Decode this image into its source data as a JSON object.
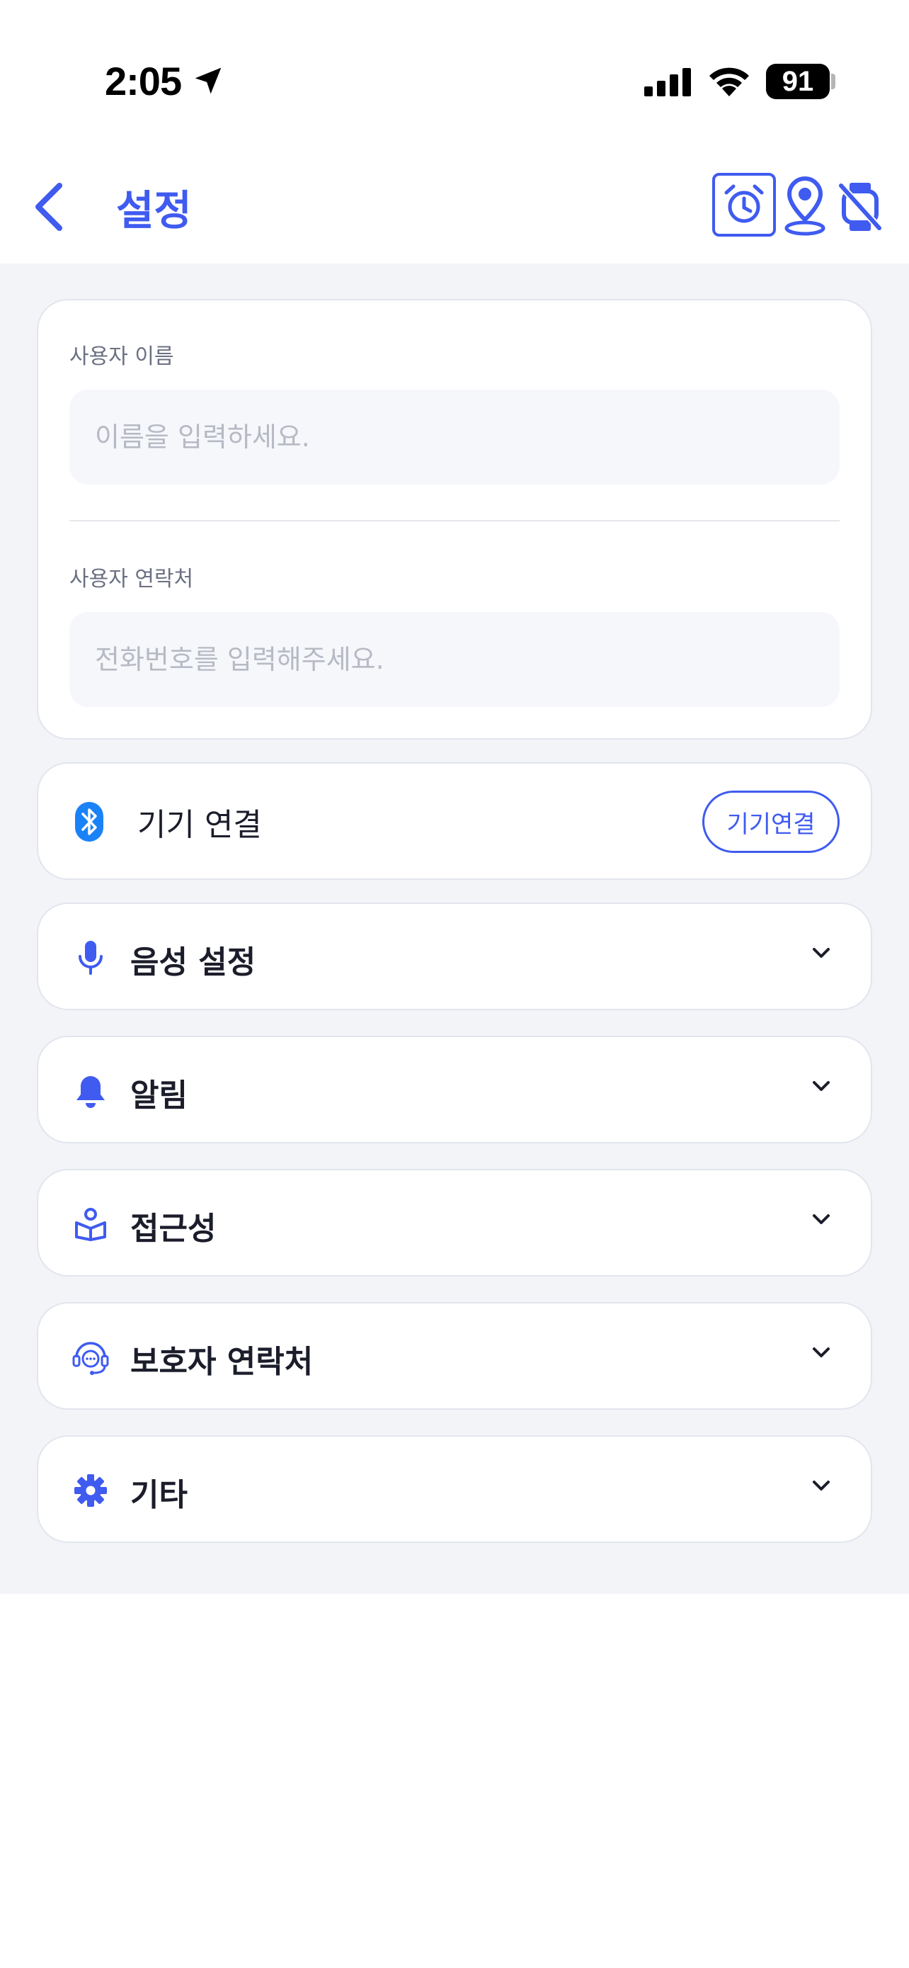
{
  "status_bar": {
    "time": "2:05",
    "battery": "91"
  },
  "nav": {
    "title": "설정"
  },
  "user": {
    "name_label": "사용자 이름",
    "name_placeholder": "이름을 입력하세요.",
    "contact_label": "사용자 연락처",
    "contact_placeholder": "전화번호를 입력해주세요."
  },
  "device": {
    "label": "기기 연결",
    "button": "기기연결"
  },
  "sections": [
    {
      "label": "음성 설정",
      "icon": "microphone-icon"
    },
    {
      "label": "알림",
      "icon": "bell-icon"
    },
    {
      "label": "접근성",
      "icon": "accessibility-icon"
    },
    {
      "label": "보호자 연락처",
      "icon": "headset-icon"
    },
    {
      "label": "기타",
      "icon": "gear-icon"
    }
  ],
  "colors": {
    "accent": "#3f5bf0",
    "background": "#f3f4f8"
  }
}
